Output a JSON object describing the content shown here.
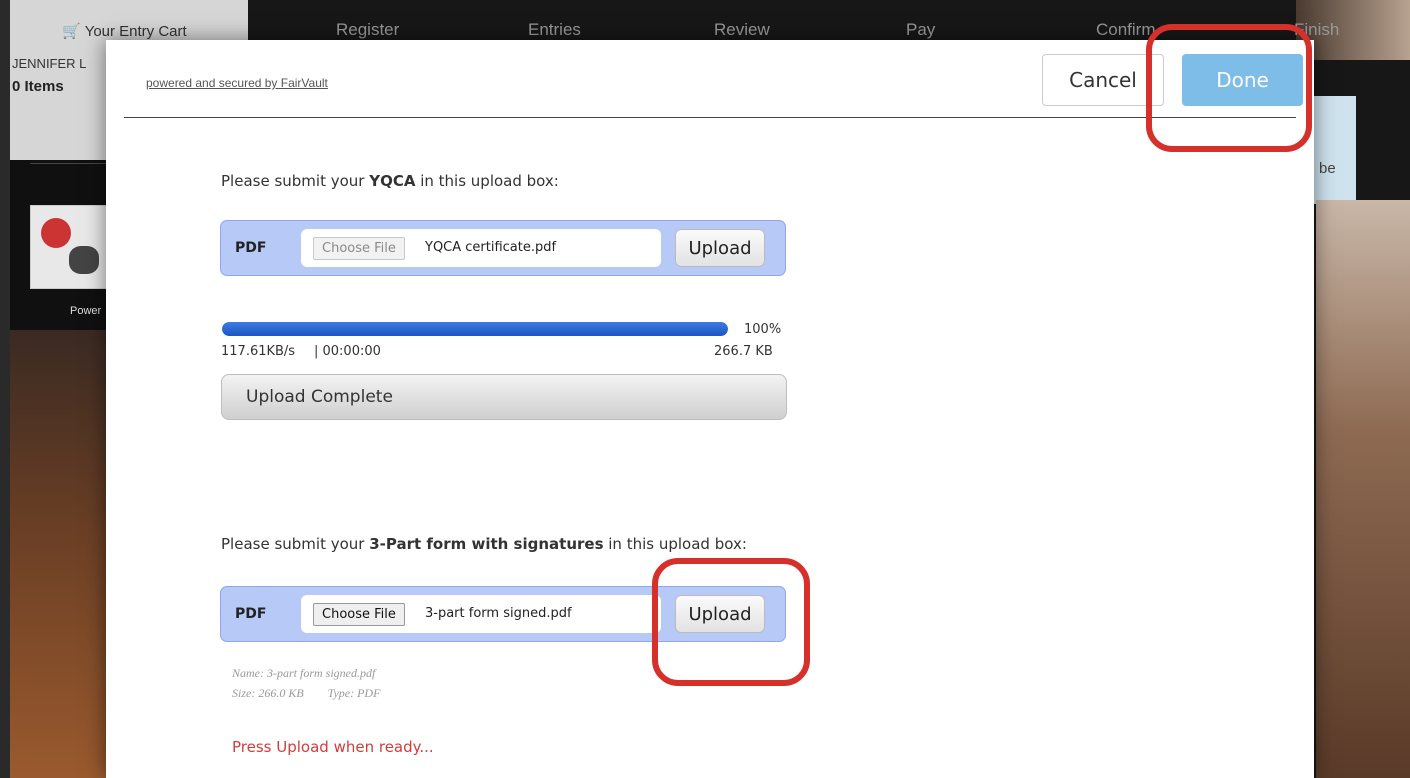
{
  "background": {
    "cart": {
      "title": "Your Entry Cart",
      "user": "JENNIFER L",
      "items": "0 Items",
      "powered": "Power"
    },
    "steps": [
      "Register",
      "Entries",
      "Review",
      "Pay",
      "Confirm",
      "Finish"
    ],
    "right_fragment": "be"
  },
  "modal": {
    "powered_link": "powered and secured by FairVault",
    "cancel_label": "Cancel",
    "done_label": "Done",
    "upload1": {
      "prompt_pre": "Please submit your ",
      "prompt_bold": "YQCA",
      "prompt_post": " in this upload box:",
      "type_label": "PDF",
      "choose_label": "Choose File",
      "file_name": "YQCA certificate.pdf",
      "upload_label": "Upload",
      "progress_percent": 100,
      "progress_text": "100%",
      "speed": "117.61KB/s",
      "time": "| 00:00:00",
      "size": "266.7 KB",
      "status": "Upload Complete"
    },
    "upload2": {
      "prompt_pre": "Please submit your ",
      "prompt_bold": "3-Part form with signatures",
      "prompt_post": " in this upload box:",
      "type_label": "PDF",
      "choose_label": "Choose File",
      "file_name": "3-part form signed.pdf",
      "upload_label": "Upload",
      "meta_name": "Name: 3-part form signed.pdf",
      "meta_size": "Size: 266.0 KB",
      "meta_type": "Type: PDF",
      "ready_message": "Press Upload when ready..."
    }
  },
  "colors": {
    "done_button": "#7dbde8",
    "upload_box": "#b6c9f7",
    "progress": "#1a56c4",
    "ready_message": "#d43b3b",
    "annotation": "#d6302a"
  }
}
